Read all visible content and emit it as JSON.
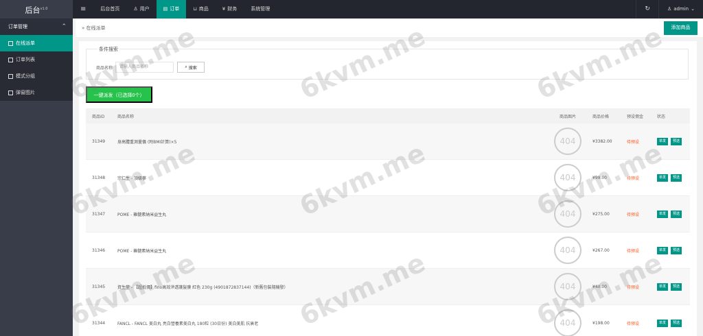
{
  "app": {
    "title": "后台",
    "version": "v1.0"
  },
  "topnav": {
    "items": [
      {
        "label": "后台首页"
      },
      {
        "label": "用户"
      },
      {
        "label": "订单"
      },
      {
        "label": "商品"
      },
      {
        "label": "财务"
      },
      {
        "label": "系统管理"
      }
    ],
    "user": "admin"
  },
  "sidebar": {
    "group": "订单管理",
    "items": [
      {
        "label": "在线派单"
      },
      {
        "label": "订单列表"
      },
      {
        "label": "模式分组"
      },
      {
        "label": "弹窗图片"
      }
    ]
  },
  "header": {
    "breadcrumb": "在线派单",
    "add_button": "添加商品"
  },
  "search": {
    "legend": "条件搜索",
    "label": "商品名称",
    "placeholder": "请输入商品名称",
    "button": "搜索"
  },
  "batch_button": "一键派发（已选择0个）",
  "table": {
    "headers": {
      "id": "商品ID",
      "name": "商品名称",
      "image": "商品图片",
      "price": "商品价格",
      "commission": "预设佣金",
      "status": "状态"
    },
    "rows": [
      {
        "id": "31349",
        "name": "身高體重測量儀 (附BMI計算)×5",
        "image": "404",
        "price": "¥3382.00",
        "commission": "待预设",
        "btn1": "单发",
        "btn2": "预选"
      },
      {
        "id": "31348",
        "name": "宗仁生 - 頂級蔘",
        "image": "404",
        "price": "¥99.00",
        "commission": "待预设",
        "btn1": "单发",
        "btn2": "预选"
      },
      {
        "id": "31347",
        "name": "POME - 雞髓素納米益生丸",
        "image": "404",
        "price": "¥275.00",
        "commission": "待预设",
        "btn1": "单发",
        "btn2": "预选"
      },
      {
        "id": "31346",
        "name": "POME - 雞髓素納米益生丸",
        "image": "404",
        "price": "¥267.00",
        "commission": "待预设",
        "btn1": "单发",
        "btn2": "预选"
      },
      {
        "id": "31345",
        "name": "資生堂 - 【超抵價】fino高效滲透護髮膜 紅色 230g (4901872837144)（新舊包裝隨機發）",
        "image": "404",
        "price": "¥40.00",
        "commission": "待预设",
        "btn1": "单发",
        "btn2": "预选"
      },
      {
        "id": "31344",
        "name": "FANCL - FANCL 美白丸 亮白營養素美白丸 180粒 (30日份) 美白美肌 抗衰老",
        "image": "404",
        "price": "¥198.00",
        "commission": "待预设",
        "btn1": "单发",
        "btn2": "预选"
      }
    ]
  },
  "watermark": "6kvm.me",
  "colors": {
    "accent": "#009688",
    "green": "#27c24c",
    "pending": "#ff5722",
    "topbar": "#23262e",
    "sidebar": "#393d49"
  }
}
